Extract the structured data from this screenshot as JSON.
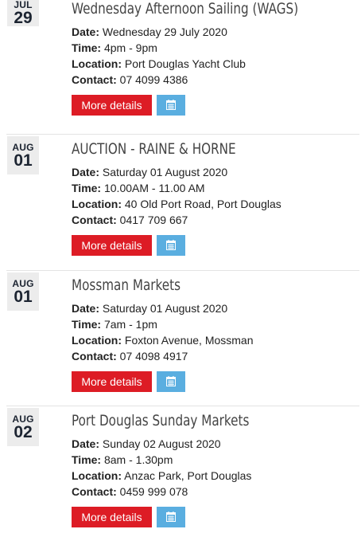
{
  "events": [
    {
      "month": "JUL",
      "day": "29",
      "title": "Wednesday Afternoon Sailing (WAGS)",
      "date_label": "Date:",
      "date": "Wednesday 29 July 2020",
      "time_label": "Time:",
      "time": "4pm - 9pm",
      "location_label": "Location:",
      "location": "Port Douglas Yacht Club",
      "contact_label": "Contact:",
      "contact": "07 4099 4386",
      "more_label": "More details",
      "calendar_icon": "calendar-icon"
    },
    {
      "month": "AUG",
      "day": "01",
      "title": "AUCTION - RAINE & HORNE",
      "date_label": "Date:",
      "date": "Saturday 01 August 2020",
      "time_label": "Time:",
      "time": "10.00AM - 11.00 AM",
      "location_label": "Location:",
      "location": "40 Old Port Road, Port Douglas",
      "contact_label": "Contact:",
      "contact": "0417 709 667",
      "more_label": "More details",
      "calendar_icon": "calendar-icon"
    },
    {
      "month": "AUG",
      "day": "01",
      "title": "Mossman Markets",
      "date_label": "Date:",
      "date": "Saturday 01 August 2020",
      "time_label": "Time:",
      "time": "7am - 1pm",
      "location_label": "Location:",
      "location": "Foxton Avenue, Mossman",
      "contact_label": "Contact:",
      "contact": "07 4098 4917",
      "more_label": "More details",
      "calendar_icon": "calendar-icon"
    },
    {
      "month": "AUG",
      "day": "02",
      "title": "Port Douglas Sunday Markets",
      "date_label": "Date:",
      "date": "Sunday 02 August 2020",
      "time_label": "Time:",
      "time": "8am - 1.30pm",
      "location_label": "Location:",
      "location": "Anzac Park, Port Douglas",
      "contact_label": "Contact:",
      "contact": "0459 999 078",
      "more_label": "More details",
      "calendar_icon": "calendar-icon"
    }
  ],
  "colors": {
    "more_button": "#dd1c25",
    "calendar_button": "#5aaee0",
    "date_badge": "#ececec",
    "divider": "#e3e3e3"
  }
}
